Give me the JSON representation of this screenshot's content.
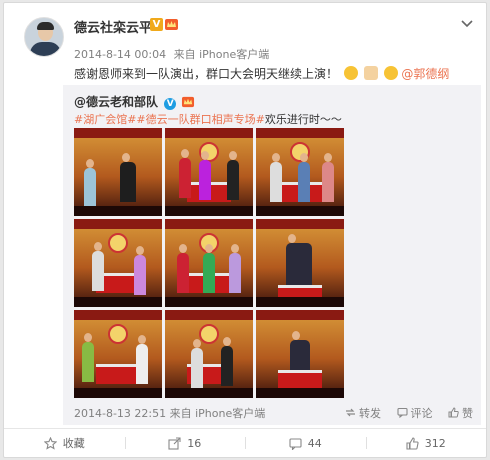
{
  "post": {
    "author": "德云社栾云平",
    "verified_badge": "V",
    "time": "2014-8-14 00:04",
    "source": "来自 iPhone客户端",
    "text": "感谢恩师来到一队演出，群口大会明天继续上演！",
    "mention": "@郭德纲"
  },
  "repost": {
    "author": "@德云老和部队",
    "tags": "#湖广会馆##德云一队群口相声专场#",
    "text_tail": "欢乐进行时～～",
    "time": "2014-8-13 22:51",
    "source": "来自 iPhone客户端",
    "actions": {
      "repost": "转发",
      "comment": "评论",
      "like": "赞"
    }
  },
  "footer": {
    "favorite": "收藏",
    "reposts": "16",
    "comments": "44",
    "likes": "312"
  },
  "colors": {
    "accent": "#eb7350",
    "verified": "#f0a91b",
    "repost_bg": "#f2f2f5"
  },
  "icons": [
    "chevron-down-icon",
    "favorite-star-icon",
    "repost-icon",
    "comment-icon",
    "like-icon"
  ]
}
